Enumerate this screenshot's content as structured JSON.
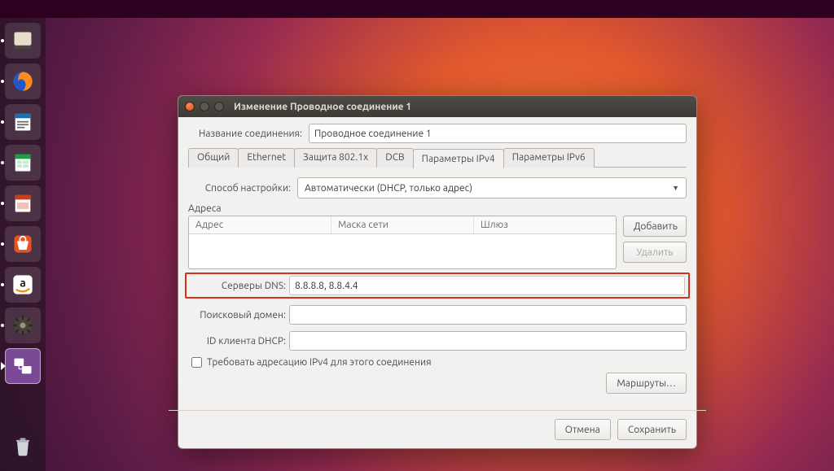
{
  "window": {
    "title": "Изменение Проводное соединение 1",
    "connection_name_label": "Название соединения:",
    "connection_name_value": "Проводное соединение 1"
  },
  "tabs": [
    {
      "label": "Общий",
      "active": false
    },
    {
      "label": "Ethernet",
      "active": false
    },
    {
      "label": "Защита 802.1x",
      "active": false
    },
    {
      "label": "DCB",
      "active": false
    },
    {
      "label": "Параметры IPv4",
      "active": true
    },
    {
      "label": "Параметры IPv6",
      "active": false
    }
  ],
  "ipv4": {
    "method_label": "Способ настройки:",
    "method_value": "Автоматически (DHCP, только адрес)",
    "addresses_section_label": "Адреса",
    "addr_cols": {
      "address": "Адрес",
      "netmask": "Маска сети",
      "gateway": "Шлюз"
    },
    "btn_add": "Добавить",
    "btn_delete": "Удалить",
    "dns_label": "Серверы DNS:",
    "dns_value": "8.8.8.8, 8.8.4.4",
    "search_label": "Поисковый домен:",
    "search_value": "",
    "dhcp_id_label": "ID клиента DHCP:",
    "dhcp_id_value": "",
    "require_ipv4_label": "Требовать адресацию IPv4 для этого соединения",
    "routes_btn": "Маршруты…"
  },
  "footer": {
    "cancel": "Отмена",
    "save": "Сохранить"
  },
  "launcher": [
    {
      "name": "files-icon"
    },
    {
      "name": "firefox-icon"
    },
    {
      "name": "writer-icon"
    },
    {
      "name": "calc-icon"
    },
    {
      "name": "impress-icon"
    },
    {
      "name": "software-center-icon"
    },
    {
      "name": "amazon-icon"
    },
    {
      "name": "settings-icon"
    },
    {
      "name": "network-settings-icon",
      "active": true
    }
  ]
}
